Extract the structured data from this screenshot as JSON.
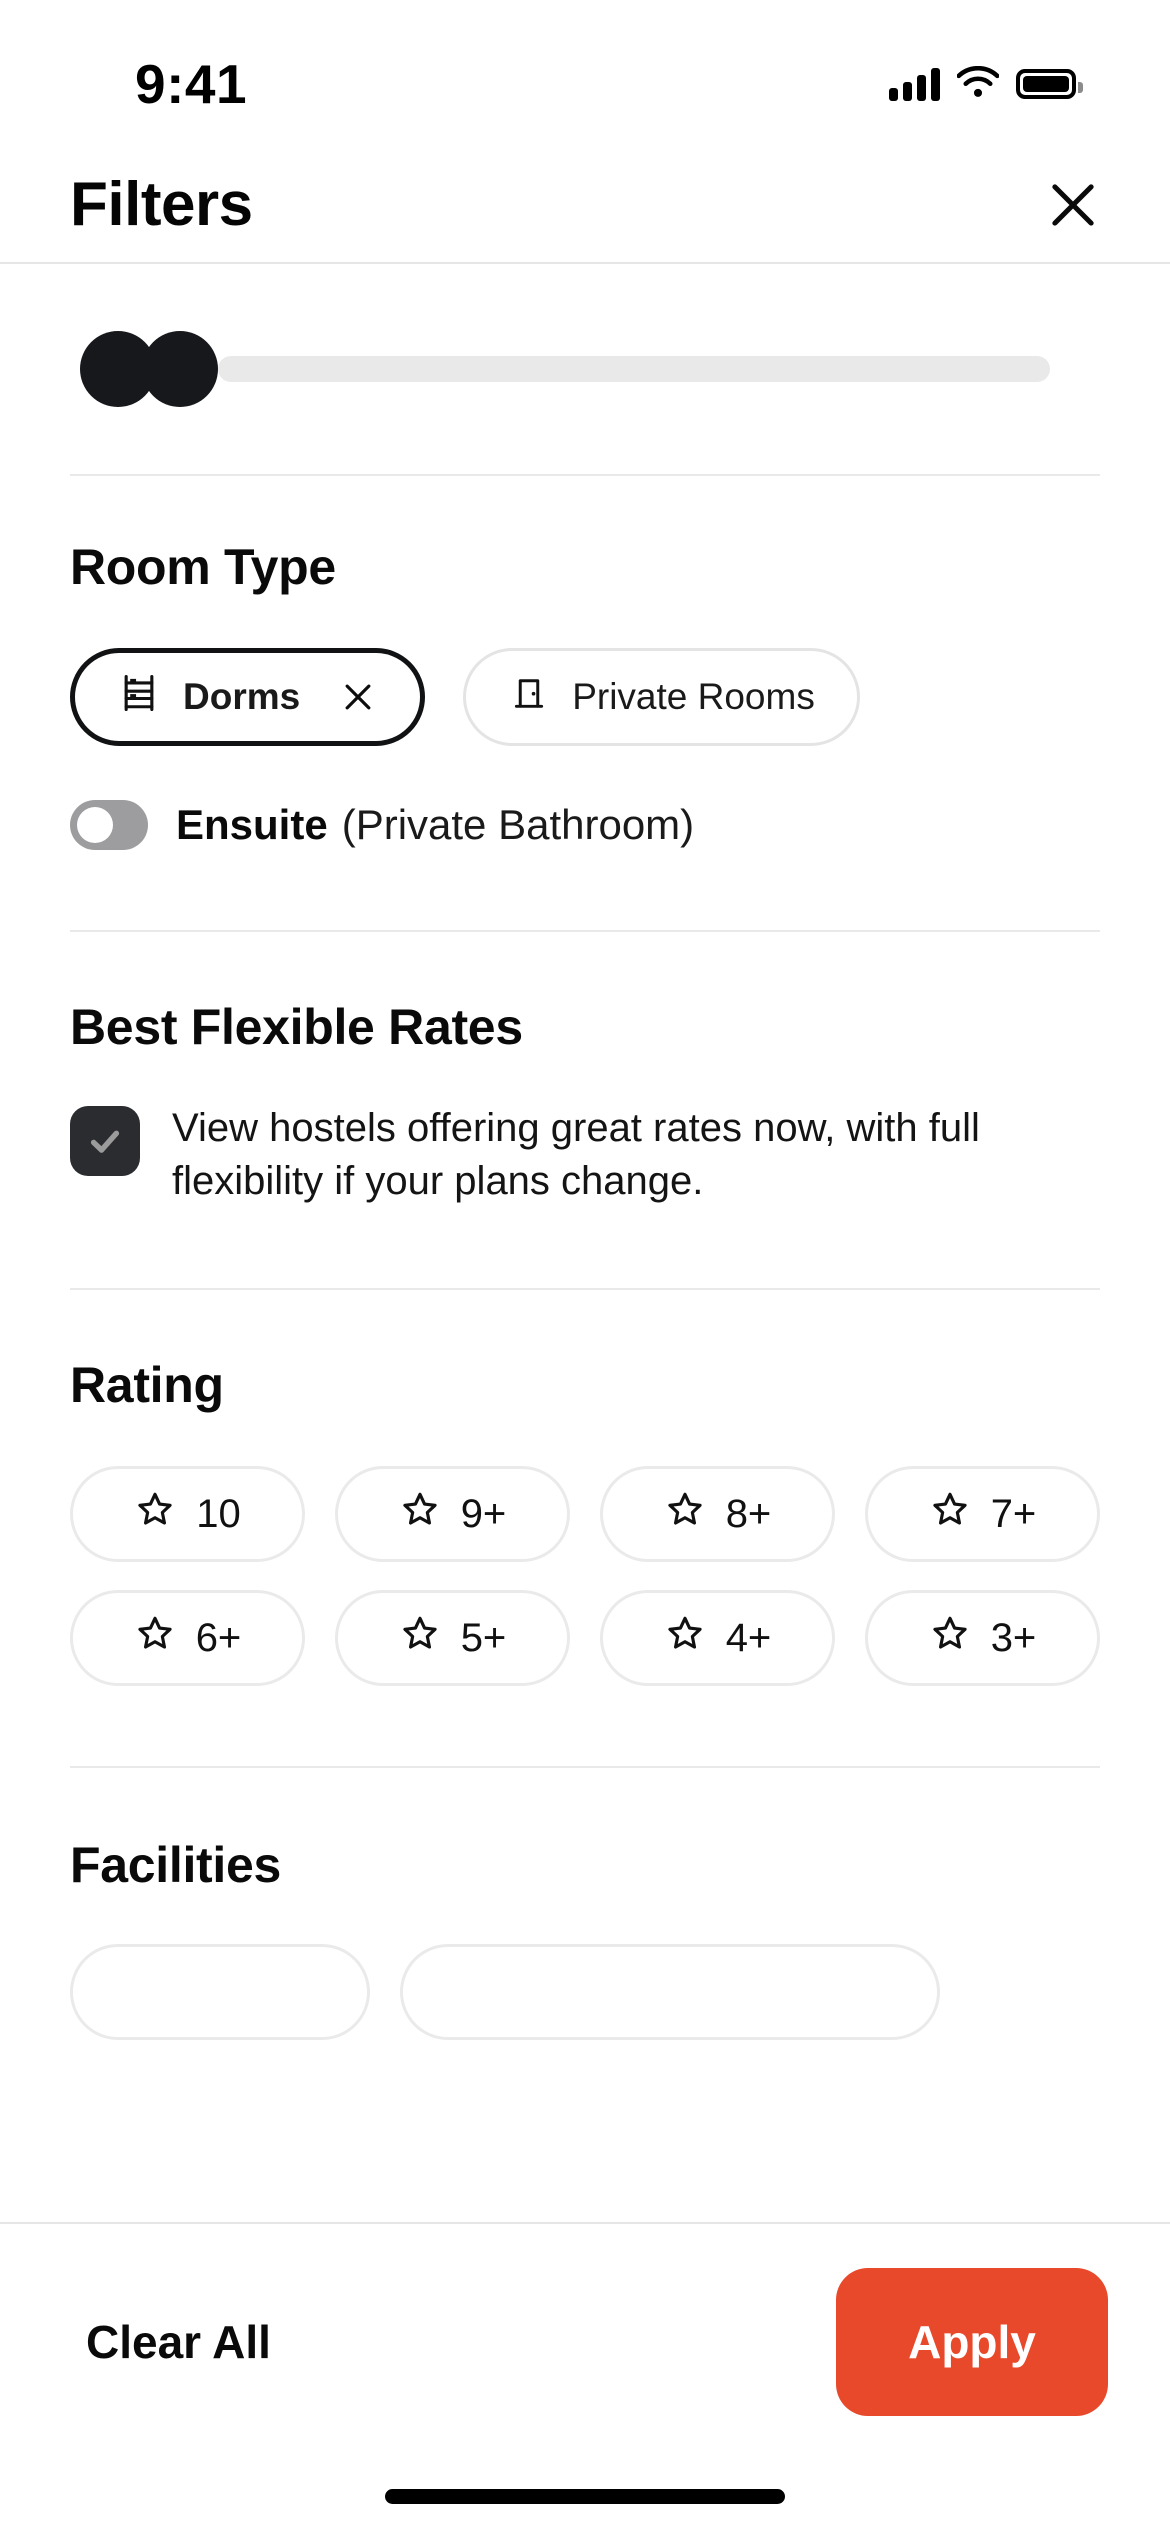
{
  "status_bar": {
    "time": "9:41",
    "cellular_icon": "cellular-signal-icon",
    "wifi_icon": "wifi-icon",
    "battery_icon": "battery-full-icon"
  },
  "header": {
    "title": "Filters",
    "close_icon": "close-icon"
  },
  "price_slider": {
    "track_color": "#e9e9e9",
    "handle_color": "#17181c",
    "low_handle_label": "minimum-price-handle",
    "high_handle_label": "maximum-price-handle"
  },
  "room_type": {
    "title": "Room Type",
    "options": [
      {
        "label": "Dorms",
        "icon": "bunk-bed-icon",
        "selected": true,
        "remove_icon": "close-icon"
      },
      {
        "label": "Private Rooms",
        "icon": "door-icon",
        "selected": false
      }
    ],
    "ensuite": {
      "label_strong": "Ensuite",
      "label_normal": "(Private Bathroom)",
      "enabled": false,
      "toggle_color": "#9d9d9f"
    }
  },
  "best_flexible_rates": {
    "title": "Best Flexible Rates",
    "description": "View hostels offering great rates now, with full flexibility if your plans change.",
    "checked": true,
    "checkbox_color": "#2b2c2f",
    "check_icon": "check-icon"
  },
  "rating": {
    "title": "Rating",
    "options": [
      {
        "label": "10",
        "icon": "star-icon"
      },
      {
        "label": "9+",
        "icon": "star-icon"
      },
      {
        "label": "8+",
        "icon": "star-icon"
      },
      {
        "label": "7+",
        "icon": "star-icon"
      },
      {
        "label": "6+",
        "icon": "star-icon"
      },
      {
        "label": "5+",
        "icon": "star-icon"
      },
      {
        "label": "4+",
        "icon": "star-icon"
      },
      {
        "label": "3+",
        "icon": "star-icon"
      }
    ]
  },
  "facilities": {
    "title": "Facilities"
  },
  "footer": {
    "clear_all_label": "Clear All",
    "apply_label": "Apply",
    "apply_color": "#e8492a"
  }
}
